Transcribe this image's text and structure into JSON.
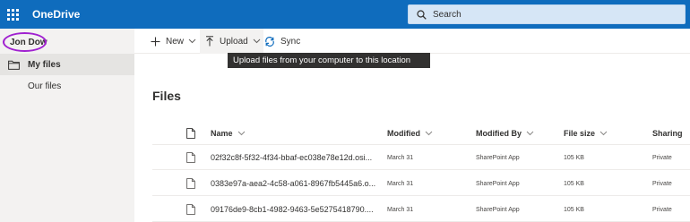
{
  "app": {
    "title": "OneDrive"
  },
  "search": {
    "placeholder": "Search"
  },
  "user": {
    "name": "Jon Dow"
  },
  "nav": {
    "items": [
      {
        "label": "My files"
      },
      {
        "label": "Our files"
      }
    ]
  },
  "toolbar": {
    "new_label": "New",
    "upload_label": "Upload",
    "sync_label": "Sync"
  },
  "tooltip": {
    "text": "Upload files from your computer to this location"
  },
  "main": {
    "title": "Files",
    "columns": {
      "name": "Name",
      "modified": "Modified",
      "modified_by": "Modified By",
      "file_size": "File size",
      "sharing": "Sharing"
    },
    "rows": [
      {
        "name": "02f32c8f-5f32-4f34-bbaf-ec038e78e12d.osi...",
        "modified": "March 31",
        "modified_by": "SharePoint App",
        "size": "105 KB",
        "sharing": "Private"
      },
      {
        "name": "0383e97a-aea2-4c58-a061-8967fb5445a6.o...",
        "modified": "March 31",
        "modified_by": "SharePoint App",
        "size": "105 KB",
        "sharing": "Private"
      },
      {
        "name": "09176de9-8cb1-4982-9463-5e5275418790....",
        "modified": "March 31",
        "modified_by": "SharePoint App",
        "size": "105 KB",
        "sharing": "Private"
      }
    ]
  },
  "colors": {
    "suite_bar": "#0f6cbd",
    "nav_bg": "#f3f2f1",
    "highlight_ring": "#a020d0",
    "tooltip_bg": "#323130"
  }
}
